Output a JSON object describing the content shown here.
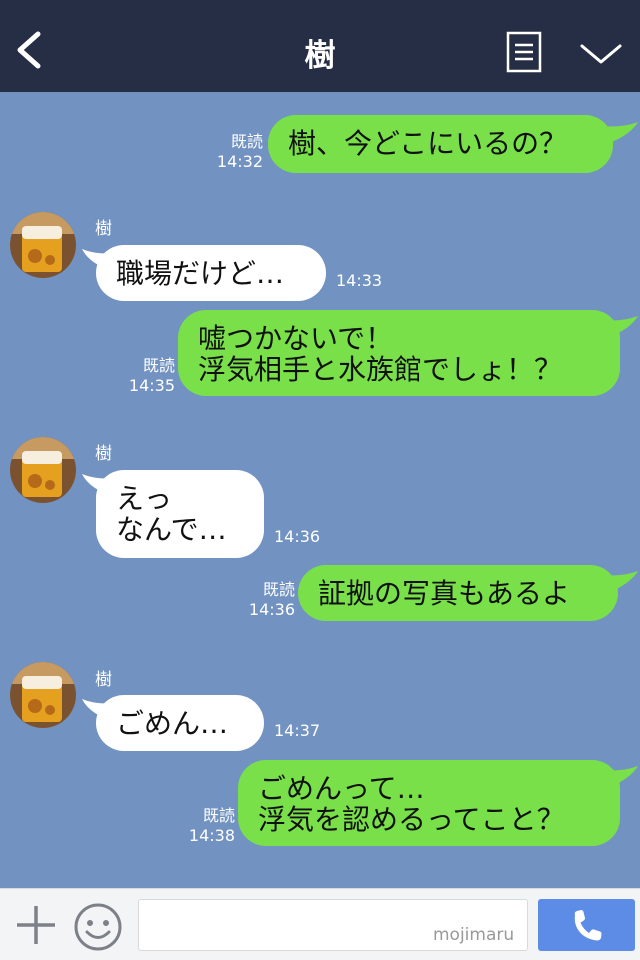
{
  "header": {
    "title": "樹",
    "back_icon": "chevron-left-icon",
    "menu_icon": "list-menu-icon",
    "collapse_icon": "chevron-down-icon"
  },
  "colors": {
    "header_bg": "#252e45",
    "chat_bg": "#7293c2",
    "outgoing_bubble": "#79e04a",
    "incoming_bubble": "#ffffff",
    "send_button": "#5d8ce6"
  },
  "messages": [
    {
      "direction": "out",
      "text": "樹、今どこにいるの？",
      "read": "既読",
      "time": "14:32"
    },
    {
      "direction": "in",
      "sender": "樹",
      "text": "職場だけど…",
      "time": "14:33"
    },
    {
      "direction": "out",
      "text": "嘘つかないで！\n浮気相手と水族館でしょ！？",
      "read": "既読",
      "time": "14:35"
    },
    {
      "direction": "in",
      "sender": "樹",
      "text": "えっ\nなんで…",
      "time": "14:36"
    },
    {
      "direction": "out",
      "text": "証拠の写真もあるよ",
      "read": "既読",
      "time": "14:36"
    },
    {
      "direction": "in",
      "sender": "樹",
      "text": "ごめん…",
      "time": "14:37"
    },
    {
      "direction": "out",
      "text": "ごめんって…\n浮気を認めるってこと？",
      "read": "既読",
      "time": "14:38"
    }
  ],
  "footer": {
    "plus_icon": "plus-icon",
    "emoji_icon": "smiley-icon",
    "input_value": "",
    "watermark": "mojimaru",
    "call_icon": "phone-icon"
  }
}
